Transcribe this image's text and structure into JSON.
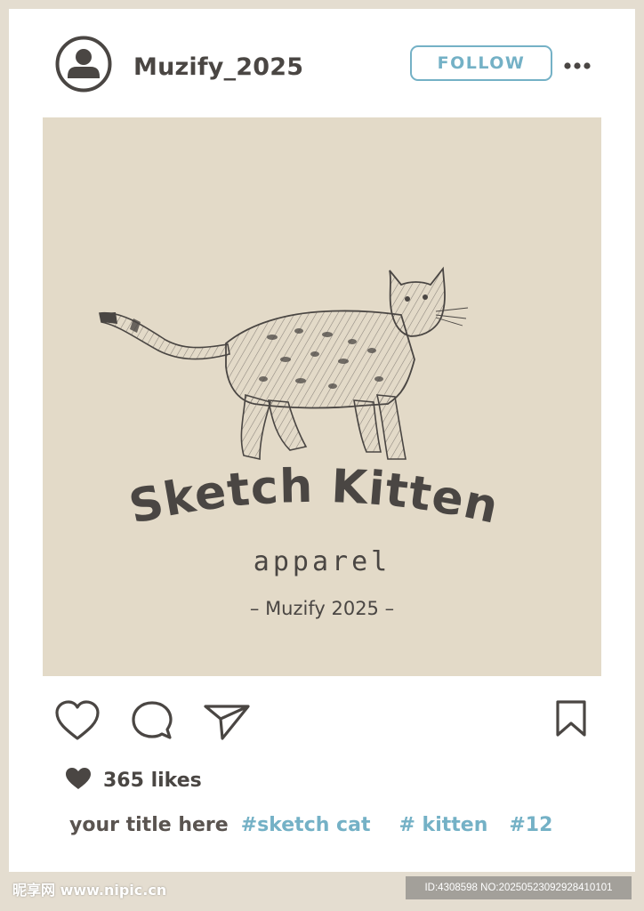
{
  "header": {
    "username": "Muzify_2025",
    "follow_label": "FOLLOW"
  },
  "post": {
    "brand_title": "Sketch Kitten",
    "brand_subtitle": "apparel",
    "brand_credit": "– Muzify 2025 –"
  },
  "footer": {
    "likes": "365 likes",
    "caption_title": "your title here",
    "hashtags": [
      "#sketch cat",
      "# kitten",
      "#12"
    ]
  },
  "watermark": {
    "left": "昵享网 www.nipic.cn",
    "right": "ID:4308598 NO:20250523092928410101"
  },
  "icons": {
    "avatar": "user-avatar-icon",
    "more": "more-dots-icon",
    "like": "heart-outline-icon",
    "comment": "comment-bubble-icon",
    "share": "paper-plane-icon",
    "save": "bookmark-icon",
    "likes_heart": "heart-filled-icon"
  },
  "colors": {
    "frame": "#e4ddd0",
    "post_bg": "#e3dac8",
    "text_dark": "#4a4643",
    "accent": "#74b1c6"
  }
}
